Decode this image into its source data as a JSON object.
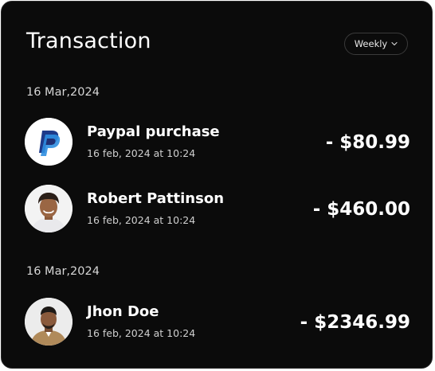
{
  "header": {
    "title": "Transaction",
    "filter_label": "Weekly",
    "filter_icon": "chevron-down-icon"
  },
  "groups": [
    {
      "date": "16 Mar,2024",
      "transactions": [
        {
          "name": "Paypal purchase",
          "time": "16 feb, 2024 at 10:24",
          "amount": "- $80.99",
          "avatar": "paypal-logo"
        },
        {
          "name": "Robert Pattinson",
          "time": "16 feb, 2024 at 10:24",
          "amount": "- $460.00",
          "avatar": "person-avatar"
        }
      ]
    },
    {
      "date": "16 Mar,2024",
      "transactions": [
        {
          "name": "Jhon Doe",
          "time": "16 feb, 2024 at 10:24",
          "amount": "- $2346.99",
          "avatar": "person-avatar"
        }
      ]
    }
  ],
  "colors": {
    "background": "#0b0b0b",
    "text": "#ffffff",
    "muted_text": "#cfcfcf",
    "paypal_dark_blue": "#1d3a8a",
    "paypal_light_blue": "#2f8ee0"
  }
}
